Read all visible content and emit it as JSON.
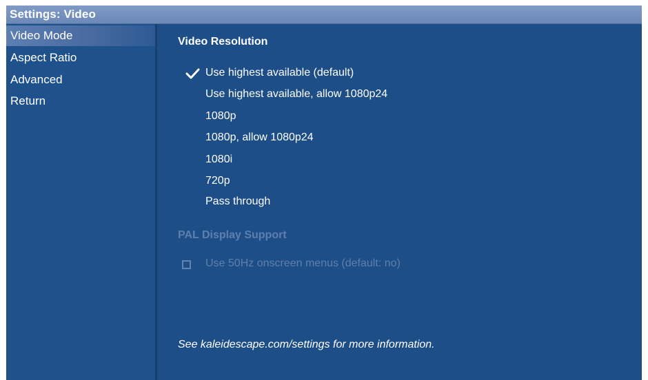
{
  "window": {
    "title": "Settings: Video"
  },
  "sidebar": {
    "items": [
      {
        "label": "Video Mode",
        "selected": true
      },
      {
        "label": "Aspect Ratio",
        "selected": false
      },
      {
        "label": "Advanced",
        "selected": false
      },
      {
        "label": "Return",
        "selected": false
      }
    ]
  },
  "video_resolution": {
    "heading": "Video Resolution",
    "options": [
      {
        "label": "Use highest available (default)",
        "checked": true
      },
      {
        "label": "Use highest available, allow 1080p24",
        "checked": false
      },
      {
        "label": "1080p",
        "checked": false
      },
      {
        "label": "1080p, allow 1080p24",
        "checked": false
      },
      {
        "label": "1080i",
        "checked": false
      },
      {
        "label": "720p",
        "checked": false
      },
      {
        "label": "Pass through",
        "checked": false
      }
    ]
  },
  "pal_display": {
    "heading": "PAL Display Support",
    "enabled": false,
    "checkbox_label": "Use 50Hz onscreen menus (default: no)",
    "checked": false
  },
  "footer": {
    "note": "See kaleidescape.com/settings for more information."
  },
  "colors": {
    "background": "#1c4d86",
    "titlebar": "#7f9ac5",
    "selected_item": "#5e7fb2",
    "text": "#ffffff",
    "disabled_text": "#5f7fac"
  },
  "icons": {
    "selected_option": "checkmark-icon",
    "checkbox": "checkbox-icon"
  }
}
